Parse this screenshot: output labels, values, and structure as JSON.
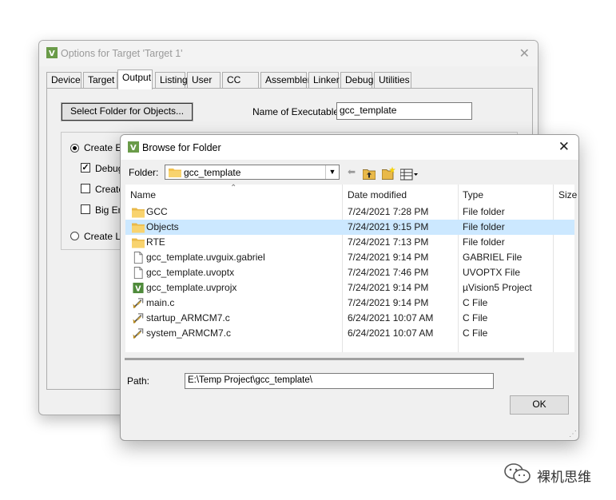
{
  "back_dialog": {
    "title": "Options for Target 'Target 1'",
    "tabs": [
      "Device",
      "Target",
      "Output",
      "Listing",
      "User",
      "CC",
      "Assembler",
      "Linker",
      "Debug",
      "Utilities"
    ],
    "active_tab": "Output",
    "select_folder_button": "Select Folder for Objects...",
    "name_of_executable_label": "Name of Executable:",
    "name_of_executable_value": "gcc_template",
    "options": {
      "create_executable": "Create Ex",
      "debug": "Debug",
      "create": "Create",
      "big_endian": "Big En",
      "create_library": "Create Lib"
    }
  },
  "front_dialog": {
    "title": "Browse for Folder",
    "folder_label": "Folder:",
    "folder_value": "gcc_template",
    "columns": {
      "name": "Name",
      "date": "Date modified",
      "type": "Type",
      "size": "Size"
    },
    "files": [
      {
        "name": "GCC",
        "date": "7/24/2021 7:28 PM",
        "type": "File folder",
        "icon": "folder-icon"
      },
      {
        "name": "Objects",
        "date": "7/24/2021 9:15 PM",
        "type": "File folder",
        "icon": "folder-icon",
        "selected": true
      },
      {
        "name": "RTE",
        "date": "7/24/2021 7:13 PM",
        "type": "File folder",
        "icon": "folder-icon"
      },
      {
        "name": "gcc_template.uvguix.gabriel",
        "date": "7/24/2021 9:14 PM",
        "type": "GABRIEL File",
        "icon": "file-icon"
      },
      {
        "name": "gcc_template.uvoptx",
        "date": "7/24/2021 7:46 PM",
        "type": "UVOPTX File",
        "icon": "file-icon"
      },
      {
        "name": "gcc_template.uvprojx",
        "date": "7/24/2021 9:14 PM",
        "type": "µVision5 Project",
        "icon": "uvision-project-icon"
      },
      {
        "name": "main.c",
        "date": "7/24/2021 9:14 PM",
        "type": "C File",
        "icon": "c-file-icon"
      },
      {
        "name": "startup_ARMCM7.c",
        "date": "6/24/2021 10:07 AM",
        "type": "C File",
        "icon": "c-file-icon"
      },
      {
        "name": "system_ARMCM7.c",
        "date": "6/24/2021 10:07 AM",
        "type": "C File",
        "icon": "c-file-icon"
      }
    ],
    "path_label": "Path:",
    "path_value": "E:\\Temp Project\\gcc_template\\",
    "ok_button": "OK"
  },
  "watermark": {
    "text": "裸机思维"
  },
  "colors": {
    "selected_row": "#cce8ff",
    "folder": "#f3c24f",
    "dialog_bg": "#f0f0f0"
  }
}
